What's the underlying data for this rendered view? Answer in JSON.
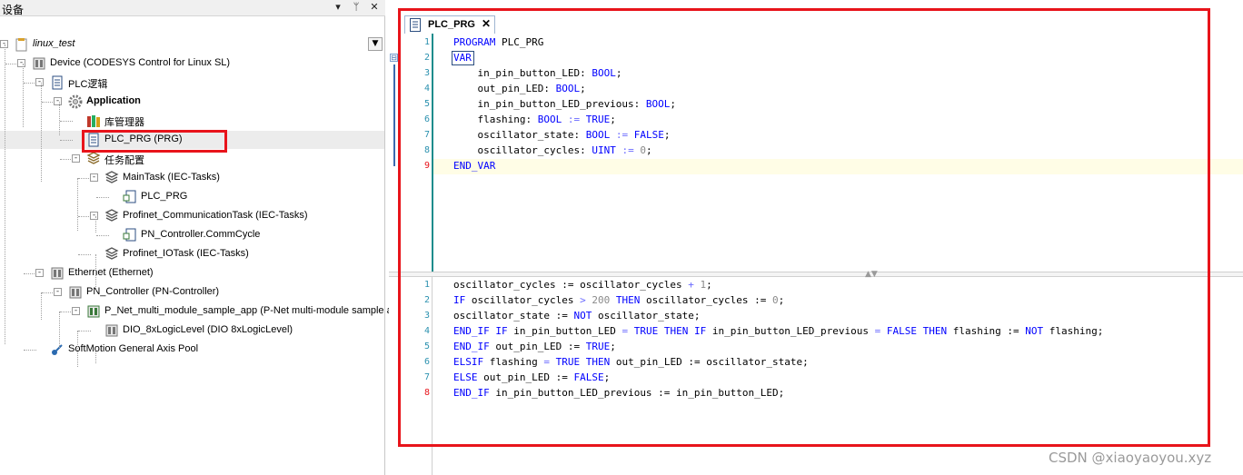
{
  "panel": {
    "title": "设备",
    "buttons": [
      "▾",
      "ᛘ",
      "✕"
    ]
  },
  "tree": [
    {
      "label": "linux_test",
      "icon": "project-icon",
      "italic": true,
      "expander": "-"
    },
    {
      "label": "Device (CODESYS Control for Linux SL)",
      "icon": "device-icon",
      "expander": "-"
    },
    {
      "label": "PLC逻辑",
      "icon": "plc-logic-icon",
      "expander": "-"
    },
    {
      "label": "Application",
      "icon": "application-gear-icon",
      "bold": true,
      "expander": "-"
    },
    {
      "label": "库管理器",
      "icon": "library-manager-icon"
    },
    {
      "label": "PLC_PRG (PRG)",
      "icon": "pou-icon",
      "selected": true
    },
    {
      "label": "任务配置",
      "icon": "task-config-icon",
      "expander": "-"
    },
    {
      "label": "MainTask (IEC-Tasks)",
      "icon": "task-icon",
      "expander": "-"
    },
    {
      "label": "PLC_PRG",
      "icon": "program-call-icon"
    },
    {
      "label": "Profinet_CommunicationTask (IEC-Tasks)",
      "icon": "task-icon",
      "expander": "-"
    },
    {
      "label": "PN_Controller.CommCycle",
      "icon": "program-call-icon"
    },
    {
      "label": "Profinet_IOTask (IEC-Tasks)",
      "icon": "task-icon"
    },
    {
      "label": "Ethernet (Ethernet)",
      "icon": "ethernet-icon",
      "expander": "-"
    },
    {
      "label": "PN_Controller (PN-Controller)",
      "icon": "pn-controller-icon",
      "expander": "-"
    },
    {
      "label": "P_Net_multi_module_sample_app (P-Net multi-module sample ap",
      "icon": "pn-device-icon",
      "expander": "-"
    },
    {
      "label": "DIO_8xLogicLevel (DIO 8xLogicLevel)",
      "icon": "io-module-icon"
    },
    {
      "label": "SoftMotion General Axis Pool",
      "icon": "axis-pool-icon"
    }
  ],
  "editor": {
    "tab_label": "PLC_PRG",
    "tab_close": "✕",
    "declaration_lines": [
      {
        "n": "1",
        "tokens": [
          [
            "kw",
            "PROGRAM"
          ],
          [
            "t",
            " PLC_PRG"
          ]
        ]
      },
      {
        "n": "2",
        "tokens": [
          [
            "kw",
            "VAR"
          ]
        ]
      },
      {
        "n": "3",
        "tokens": [
          [
            "t",
            "    in_pin_button_LED: "
          ],
          [
            "kw",
            "BOOL"
          ],
          [
            "t",
            ";"
          ]
        ]
      },
      {
        "n": "4",
        "tokens": [
          [
            "t",
            "    out_pin_LED: "
          ],
          [
            "kw",
            "BOOL"
          ],
          [
            "t",
            ";"
          ]
        ]
      },
      {
        "n": "5",
        "tokens": [
          [
            "t",
            "    in_pin_button_LED_previous: "
          ],
          [
            "kw",
            "BOOL"
          ],
          [
            "t",
            ";"
          ]
        ]
      },
      {
        "n": "6",
        "tokens": [
          [
            "t",
            "    flashing: "
          ],
          [
            "kw",
            "BOOL"
          ],
          [
            "t",
            " "
          ],
          [
            "op",
            ":="
          ],
          [
            "t",
            " "
          ],
          [
            "kw",
            "TRUE"
          ],
          [
            "t",
            ";"
          ]
        ]
      },
      {
        "n": "7",
        "tokens": [
          [
            "t",
            "    oscillator_state: "
          ],
          [
            "kw",
            "BOOL"
          ],
          [
            "t",
            " "
          ],
          [
            "op",
            ":="
          ],
          [
            "t",
            " "
          ],
          [
            "kw",
            "FALSE"
          ],
          [
            "t",
            ";"
          ]
        ]
      },
      {
        "n": "8",
        "tokens": [
          [
            "t",
            "    oscillator_cycles: "
          ],
          [
            "kw",
            "UINT"
          ],
          [
            "t",
            " "
          ],
          [
            "op",
            ":="
          ],
          [
            "t",
            " "
          ],
          [
            "num",
            "0"
          ],
          [
            "t",
            ";"
          ]
        ]
      },
      {
        "n": "9",
        "tokens": [
          [
            "kw",
            "END_VAR"
          ]
        ]
      }
    ],
    "implementation_lines": [
      {
        "n": "1",
        "tokens": [
          [
            "t",
            "oscillator_cycles := oscillator_cycles "
          ],
          [
            "op",
            "+"
          ],
          [
            "t",
            " "
          ],
          [
            "num",
            "1"
          ],
          [
            "t",
            ";"
          ]
        ]
      },
      {
        "n": "2",
        "tokens": [
          [
            "kw",
            "IF"
          ],
          [
            "t",
            " oscillator_cycles "
          ],
          [
            "op",
            ">"
          ],
          [
            "t",
            " "
          ],
          [
            "num",
            "200"
          ],
          [
            "t",
            " "
          ],
          [
            "kw",
            "THEN"
          ],
          [
            "t",
            " oscillator_cycles := "
          ],
          [
            "num",
            "0"
          ],
          [
            "t",
            ";"
          ]
        ]
      },
      {
        "n": "3",
        "tokens": [
          [
            "t",
            "oscillator_state := "
          ],
          [
            "kw",
            "NOT"
          ],
          [
            "t",
            " oscillator_state;"
          ]
        ]
      },
      {
        "n": "4",
        "tokens": [
          [
            "kw",
            "END_IF"
          ],
          [
            "t",
            " "
          ],
          [
            "kw",
            "IF"
          ],
          [
            "t",
            " in_pin_button_LED "
          ],
          [
            "op",
            "="
          ],
          [
            "t",
            " "
          ],
          [
            "kw",
            "TRUE"
          ],
          [
            "t",
            " "
          ],
          [
            "kw",
            "THEN"
          ],
          [
            "t",
            " "
          ],
          [
            "kw",
            "IF"
          ],
          [
            "t",
            " in_pin_button_LED_previous "
          ],
          [
            "op",
            "="
          ],
          [
            "t",
            " "
          ],
          [
            "kw",
            "FALSE"
          ],
          [
            "t",
            " "
          ],
          [
            "kw",
            "THEN"
          ],
          [
            "t",
            " flashing := "
          ],
          [
            "kw",
            "NOT"
          ],
          [
            "t",
            " flashing;"
          ]
        ]
      },
      {
        "n": "5",
        "tokens": [
          [
            "kw",
            "END_IF"
          ],
          [
            "t",
            " out_pin_LED := "
          ],
          [
            "kw",
            "TRUE"
          ],
          [
            "t",
            ";"
          ]
        ]
      },
      {
        "n": "6",
        "tokens": [
          [
            "kw",
            "ELSIF"
          ],
          [
            "t",
            " flashing "
          ],
          [
            "op",
            "="
          ],
          [
            "t",
            " "
          ],
          [
            "kw",
            "TRUE"
          ],
          [
            "t",
            " "
          ],
          [
            "kw",
            "THEN"
          ],
          [
            "t",
            " out_pin_LED := oscillator_state;"
          ]
        ]
      },
      {
        "n": "7",
        "tokens": [
          [
            "kw",
            "ELSE"
          ],
          [
            "t",
            " out_pin_LED := "
          ],
          [
            "kw",
            "FALSE"
          ],
          [
            "t",
            ";"
          ]
        ]
      },
      {
        "n": "8",
        "tokens": [
          [
            "kw",
            "END_IF"
          ],
          [
            "t",
            " in_pin_button_LED_previous := in_pin_button_LED;"
          ]
        ]
      }
    ]
  },
  "watermark": "CSDN @xiaoyaoyou.xyz",
  "colors": {
    "highlight_box": "#e8141b",
    "keyword": "#0000ff",
    "line_number": "#2b91af",
    "error_line_number": "#e8141b"
  }
}
